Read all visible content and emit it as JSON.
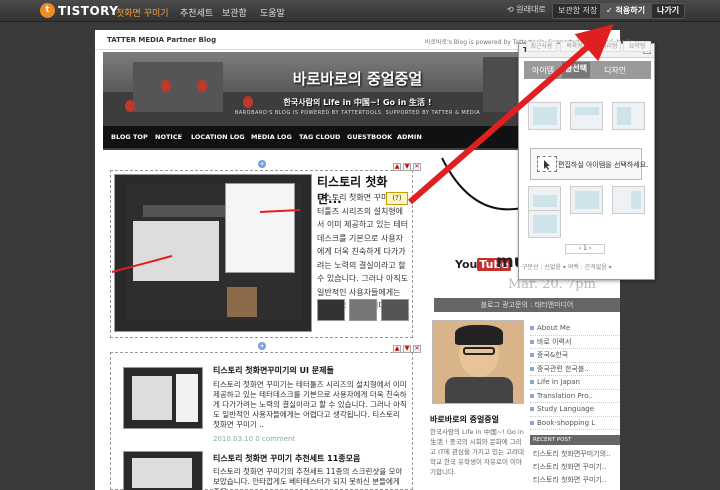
{
  "topbar": {
    "logo_glyph": "t",
    "brand": "TISTORY",
    "brand_sub": "첫화면 꾸미기",
    "nav": [
      "추천세트",
      "보관함",
      "도움말"
    ],
    "undo": "⟲ 원래대로",
    "save_to_box": "보관함 저장",
    "apply": "✓ 적용하기",
    "exit": "나가기"
  },
  "page": {
    "partner_logo": "TATTER MEDIA Partner Blog",
    "partner_credit": "바로바로's Blog is powered by Tattertools. Supported by Tatter & Media",
    "blog_title": "바로바로의 중얼중얼",
    "blog_tagline": "한국사람의 Life in 中国~! Go in 生活 !",
    "blog_tagline_small": "BAROBARO'S BLOG IS POWERED BY TATTERTOOLS. SUPPORTED BY TATTER & MEDIA",
    "menu": [
      "BLOG TOP",
      "NOTICE",
      "LOCATION LOG",
      "MEDIA LOG",
      "TAG CLOUD",
      "GUESTBOOK",
      "ADMIN"
    ]
  },
  "posts": [
    {
      "title": "티스토리 첫화면...",
      "text": "티스토리 첫화면 꾸미기는 터틀즈 시리즈의 설치형에서 이미 제공하고 있는 테터데스크를 기본으로 사용자에게 더욱 친숙하게 다가가려는 노력의 결실이라고 할 수 있습니다. 그러나 아직도 일반적인 사용자들에게는 어렵다고 생각됩니다. 티스토리 첫화면 꾸미기가",
      "controls": [
        "▲",
        "▼",
        "✕"
      ]
    },
    {
      "title": "티스토리 첫화면꾸미기의 UI 문제들",
      "text": "티스토리 첫화면 꾸미기는 테터툴즈 시리즈의 설치형에서 이미 제공하고 있는 테터데스크를 기본으로 사용자에게 더욱 친숙하게 다가가려는 노력의 결실이라고 할 수 있습니다. 그러나 아직도 일반적인 사용자들에게는 어렵다고 생각됩니다. 티스토리 첫화면 꾸미기 ..",
      "meta": "2010.03.10  0 comment",
      "controls": [
        "▲",
        "▼",
        "✕"
      ]
    },
    {
      "title": "티스토리 첫화면 꾸미기 추천세트 11종모음",
      "text": "티스토리 첫화면 꾸미기의 추천세트 11종의 스크린샷을 모아보았습니다. 안타깝게도 베타테스터가 되지 못하신 분들에게 조금",
      "controls": [
        "▲",
        "▼",
        "✕"
      ]
    }
  ],
  "sidebar": {
    "youtube_you": "You",
    "youtube_tube": "Tube",
    "mus": "mus",
    "mar": "Mar. 20. 7pm",
    "section_label": "블로그 광고문의 : 태터앤미디어",
    "profile_name": "바로바로의 중얼중얼",
    "profile_desc": "한국사람의 Life in 中国~! Go in 生活 ! 중국의 시회와 문화에 그리고 IT에 관심을 가지고 있는 고려대학교 한국 유학생이 자유로이 이야기합니다.",
    "categories": [
      "About Me",
      "바로 이력서",
      "중국&한국",
      "중국관련 한국블..",
      "Life in Japan",
      "Translation Pro..",
      "Study Language",
      "Book-shopping L"
    ],
    "recent_head": "RECENT POST",
    "recent": [
      "티스토리 첫화면꾸미기의..",
      "티스토리 첫화면 꾸미기..",
      "티스토리 첫화면 꾸미기.."
    ]
  },
  "panel": {
    "logo": "TISTORY",
    "close": "—",
    "tabs": [
      "아이템",
      "글선택",
      "디자인"
    ],
    "subtabs": [
      "최근사용",
      "목록형",
      "갤러리형",
      "요약형"
    ],
    "hint": "편집하실 아이템을 선택하세요.",
    "pager": "‹ 1 ›",
    "footer": "구분선 : 선없음 ▾  여백 : 간격없음 ▾"
  },
  "annotation": {
    "label": "(?)"
  },
  "colors": {
    "arrow": "#e02020",
    "accent": "#f08a24"
  }
}
